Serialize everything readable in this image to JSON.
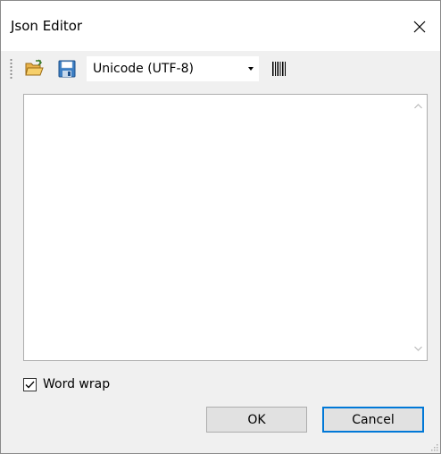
{
  "window": {
    "title": "Json Editor",
    "close_icon": "close-icon"
  },
  "toolbar": {
    "open_icon": "open-folder-icon",
    "save_icon": "save-icon",
    "encoding": {
      "selected": "Unicode (UTF-8)"
    },
    "barcode_icon": "barcode-icon"
  },
  "editor": {
    "content": ""
  },
  "options": {
    "word_wrap_label": "Word wrap",
    "word_wrap_checked": true
  },
  "buttons": {
    "ok_label": "OK",
    "cancel_label": "Cancel"
  },
  "colors": {
    "focus_border": "#0078d7",
    "button_face": "#e1e1e1",
    "window_bg": "#f0f0f0"
  }
}
